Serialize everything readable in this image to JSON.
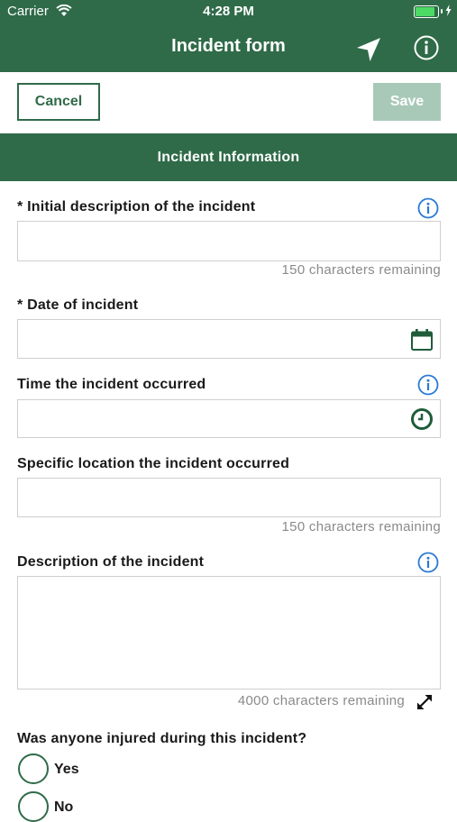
{
  "status_bar": {
    "carrier": "Carrier",
    "time": "4:28 PM",
    "battery_level": 1.0
  },
  "nav": {
    "title": "Incident form",
    "location_icon": "location-arrow-icon",
    "info_icon": "info-icon"
  },
  "actions": {
    "cancel_label": "Cancel",
    "save_label": "Save"
  },
  "section": {
    "title": "Incident Information"
  },
  "fields": {
    "initial_description": {
      "label": "* Initial description of the incident",
      "value": "",
      "remaining": "150 characters remaining"
    },
    "date": {
      "label": "* Date of incident",
      "value": "",
      "icon": "calendar-icon"
    },
    "time": {
      "label": "Time the incident occurred",
      "value": "",
      "icon": "clock-icon"
    },
    "location": {
      "label": "Specific location the incident occurred",
      "value": "",
      "remaining": "150 characters remaining"
    },
    "description": {
      "label": "Description of the incident",
      "value": "",
      "remaining": "4000 characters remaining",
      "icon": "expand-icon"
    }
  },
  "injured_question": {
    "label": "Was anyone injured during this incident?",
    "options": [
      "Yes",
      "No"
    ]
  },
  "colors": {
    "primary": "#2f6b48",
    "save_disabled": "#a9c9b8",
    "info_blue": "#2a7ad5"
  }
}
